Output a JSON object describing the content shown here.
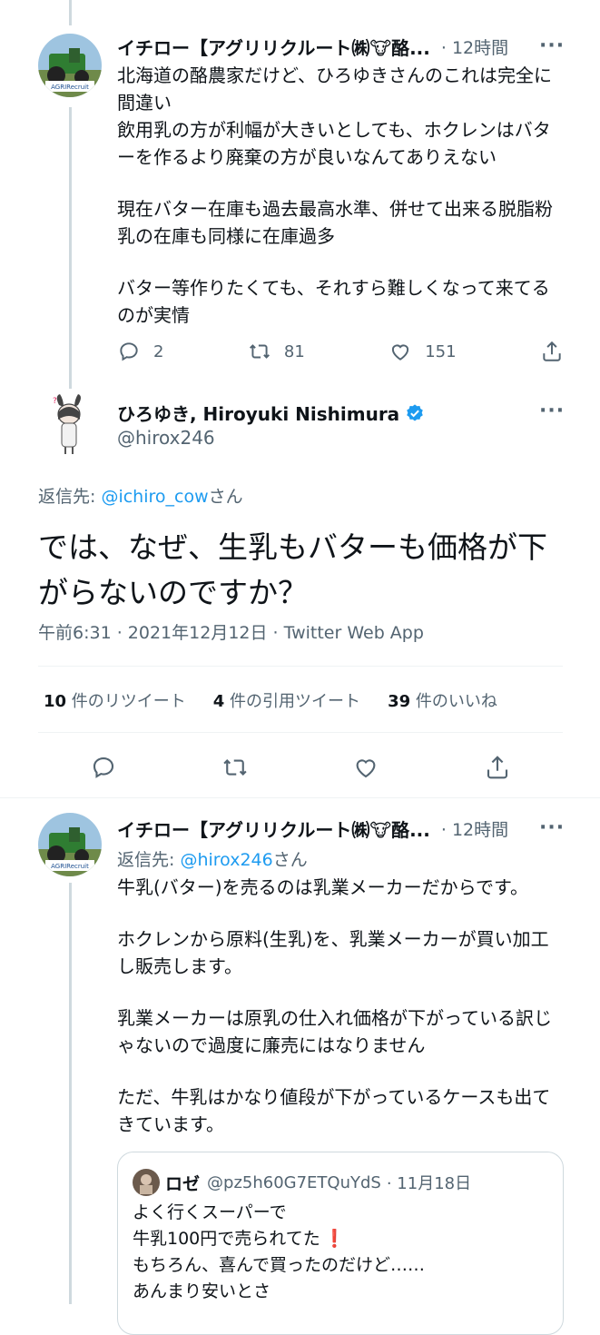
{
  "tweet1": {
    "name": "イチロー【アグリリクルート㈱🐮酪...",
    "time": "· 12時間",
    "more": "···",
    "lines": [
      "北海道の酪農家だけど、ひろゆきさんのこれは完全に間違い",
      "飲用乳の方が利幅が大きいとしても、ホクレンはバターを作るより廃棄の方が良いなんてありえない",
      "現在バター在庫も過去最高水準、併せて出来る脱脂粉乳の在庫も同様に在庫過多",
      "バター等作りたくても、それすら難しくなって来てるのが実情"
    ],
    "replies": "2",
    "retweets": "81",
    "likes": "151"
  },
  "main_tweet": {
    "name": "ひろゆき, Hiroyuki Nishimura",
    "handle": "@hirox246",
    "more": "···",
    "reply_to_prefix": "返信先: ",
    "reply_to_handle": "@ichiro_cow",
    "reply_to_suffix": "さん",
    "text": "では、なぜ、生乳もバターも価格が下がらないのですか？",
    "timestamp": "午前6:31 · 2021年12月12日 · Twitter Web App",
    "stats": {
      "retweets_count": "10",
      "retweets_label": " 件のリツイート",
      "quotes_count": "4",
      "quotes_label": " 件の引用ツイート",
      "likes_count": "39",
      "likes_label": " 件のいいね"
    }
  },
  "tweet3": {
    "name": "イチロー【アグリリクルート㈱🐮酪...",
    "time": "· 12時間",
    "more": "···",
    "reply_to_prefix": "返信先: ",
    "reply_to_handle": "@hirox246",
    "reply_to_suffix": "さん",
    "lines": [
      "牛乳(バター)を売るのは乳業メーカーだからです。",
      "ホクレンから原料(生乳)を、乳業メーカーが買い加工し販売します。",
      "乳業メーカーは原乳の仕入れ価格が下がっている訳じゃないので過度に廉売にはなりません",
      "ただ、牛乳はかなり値段が下がっているケースも出てきています。"
    ]
  },
  "quote": {
    "name": "ロゼ",
    "handle": "@pz5h60G7ETQuYdS",
    "date": "· 11月18日",
    "line1": "よく行くスーパーで",
    "line2": "牛乳100円で売られてた",
    "line2_emoji": "❗",
    "line3": "もちろん、喜んで買ったのだけど……",
    "line4": "あんまり安いとさ"
  },
  "colors": {
    "accent": "#1d9bf0",
    "muted": "#536471",
    "line": "#cfd9de"
  }
}
